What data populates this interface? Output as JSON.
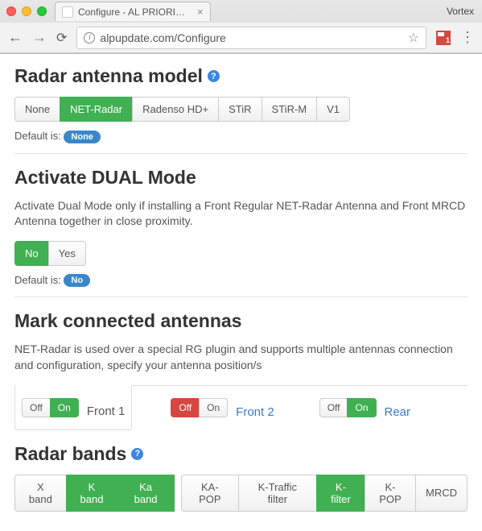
{
  "browser": {
    "tab_title": "Configure - AL PRIORITY® Firm",
    "profile": "Vortex",
    "url": "alpupdate.com/Configure",
    "ext_badge": "1"
  },
  "section1": {
    "title": "Radar antenna model",
    "options": [
      "None",
      "NET-Radar",
      "Radenso HD+",
      "STiR",
      "STiR-M",
      "V1"
    ],
    "default_prefix": "Default is: ",
    "default_value": "None"
  },
  "section2": {
    "title": "Activate DUAL Mode",
    "desc": "Activate Dual Mode only if installing a Front Regular NET-Radar Antenna and Front MRCD Antenna together in close proximity.",
    "no": "No",
    "yes": "Yes",
    "default_prefix": "Default is: ",
    "default_value": "No"
  },
  "section3": {
    "title": "Mark connected antennas",
    "desc": "NET-Radar is used over a special RG plugin and supports multiple antennas connection and configuration, specify your antenna position/s",
    "off": "Off",
    "on": "On",
    "front1": "Front 1",
    "front2": "Front 2",
    "rear": "Rear"
  },
  "section4": {
    "title": "Radar bands",
    "options": [
      "X band",
      "K band",
      "Ka band",
      "KA-POP",
      "K-Traffic filter",
      "K-filter",
      "K-POP",
      "MRCD"
    ]
  }
}
